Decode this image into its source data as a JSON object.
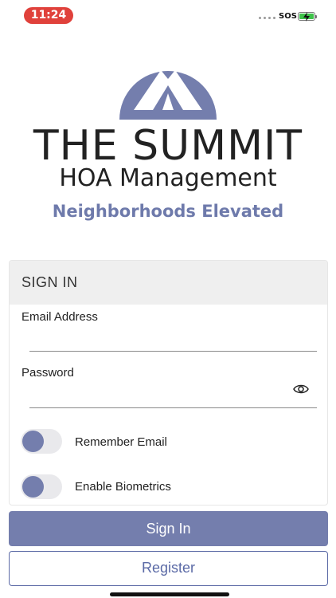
{
  "status_bar": {
    "time": "11:24",
    "carrier": "SOS"
  },
  "brand": {
    "title": "THE SUMMIT",
    "subtitle": "HOA Management",
    "tagline": "Neighborhoods Elevated",
    "colors": {
      "accent": "#747ead",
      "tagline": "#6e7aab"
    }
  },
  "signin": {
    "header": "SIGN IN",
    "email_label": "Email Address",
    "email_value": "",
    "password_label": "Password",
    "password_value": "",
    "remember_label": "Remember Email",
    "remember_on": false,
    "biometrics_label": "Enable Biometrics",
    "biometrics_on": false,
    "password_toggle_icon": "eye-icon"
  },
  "actions": {
    "signin_label": "Sign In",
    "register_label": "Register"
  }
}
